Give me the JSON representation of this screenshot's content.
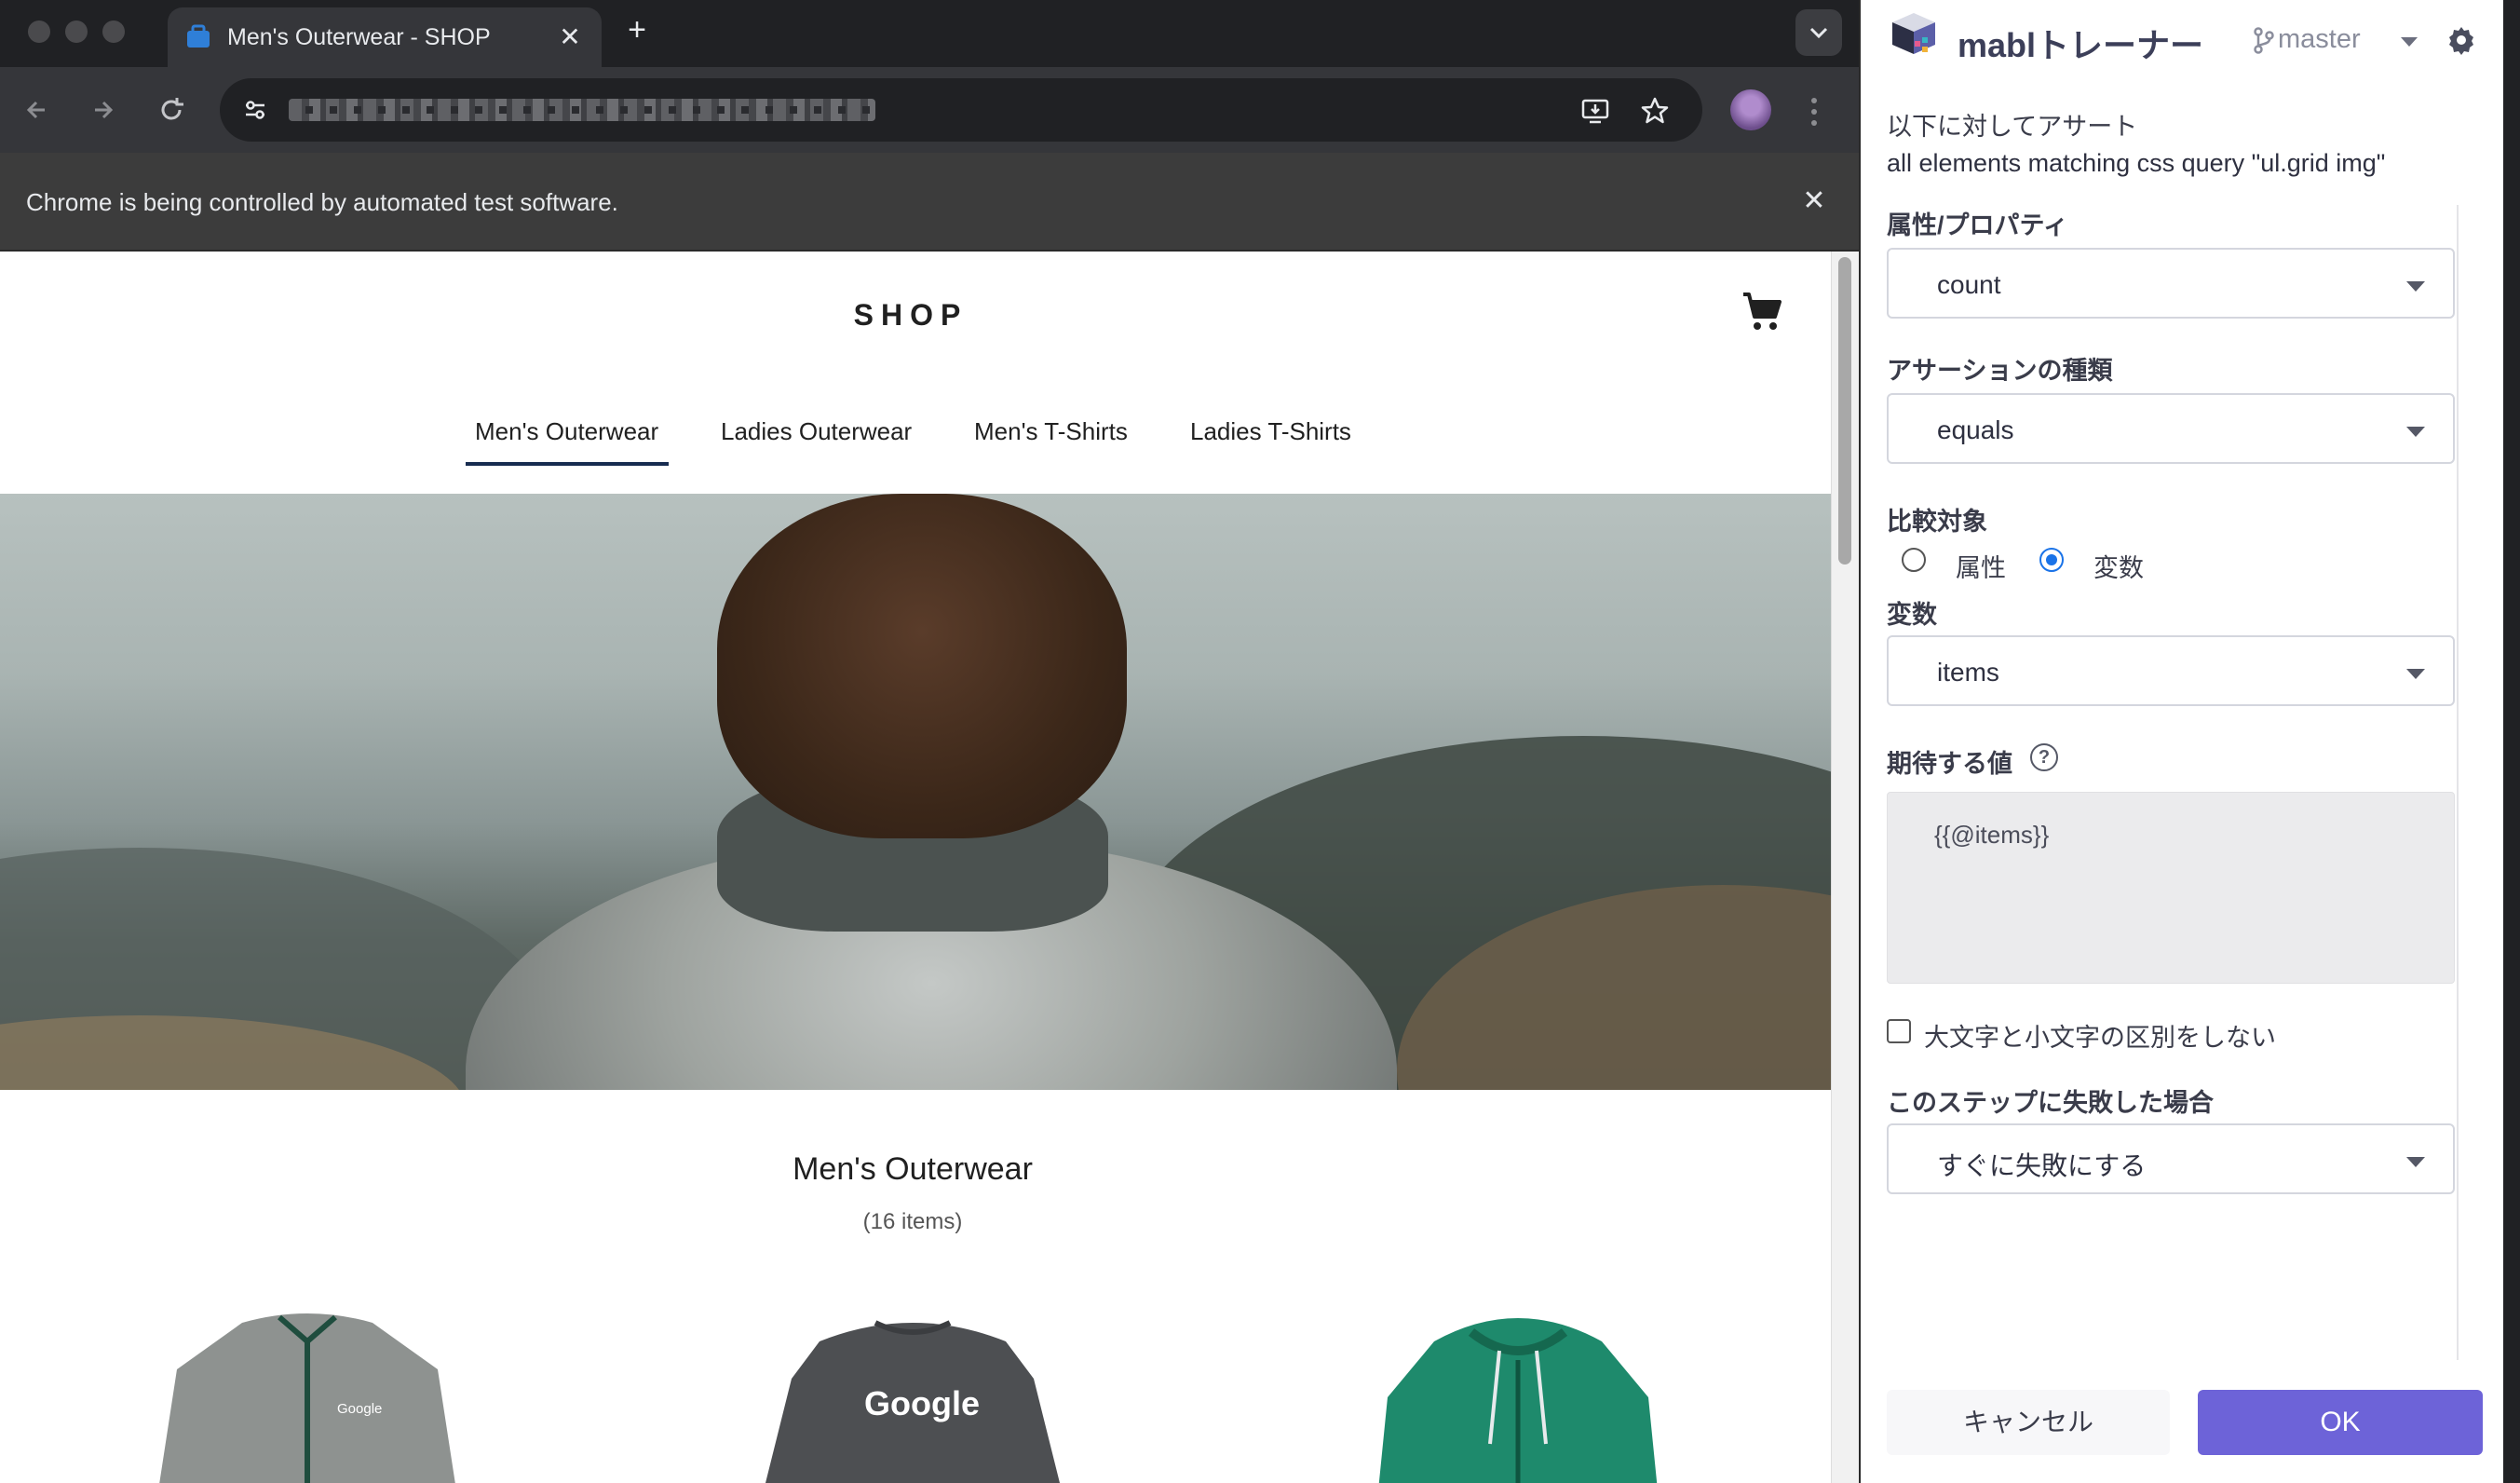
{
  "browser": {
    "tab": {
      "title": "Men's Outerwear - SHOP",
      "close_glyph": "✕"
    },
    "new_tab_glyph": "+",
    "infobar": {
      "text": "Chrome is being controlled by automated test software.",
      "close_glyph": "✕"
    }
  },
  "shop": {
    "title": "SHOP",
    "nav": [
      "Men's Outerwear",
      "Ladies Outerwear",
      "Men's T-Shirts",
      "Ladies T-Shirts"
    ],
    "active_nav": "Men's Outerwear",
    "category_title": "Men's Outerwear",
    "category_count": "(16 items)",
    "product_logo_text": "Google"
  },
  "trainer": {
    "title": "mablトレーナー",
    "branch": "master",
    "assert_heading": "以下に対してアサート",
    "assert_target": "all elements matching css query \"ul.grid img\"",
    "attribute_label": "属性/プロパティ",
    "attribute_value": "count",
    "assertion_type_label": "アサーションの種類",
    "assertion_type_value": "equals",
    "compare_label": "比較対象",
    "compare_options": [
      "属性",
      "変数"
    ],
    "compare_selected": "変数",
    "variable_label": "変数",
    "variable_value": "items",
    "expected_label": "期待する値",
    "help_glyph": "?",
    "expected_value": "{{@items}}",
    "case_insensitive_label": "大文字と小文字の区別をしない",
    "case_insensitive_checked": false,
    "on_failure_label": "このステップに失敗した場合",
    "on_failure_value": "すぐに失敗にする",
    "cancel_label": "キャンセル",
    "ok_label": "OK"
  },
  "colors": {
    "accent": "#6d63d8",
    "radio_selected": "#1a73e8",
    "nav_underline": "#172c50"
  },
  "icons": [
    "tab-favicon-icon",
    "back-arrow-icon",
    "forward-arrow-icon",
    "reload-icon",
    "site-settings-icon",
    "install-app-icon",
    "bookmark-star-icon",
    "kebab-menu-icon",
    "cart-icon",
    "branch-icon",
    "gear-icon",
    "mabl-logo-icon",
    "help-icon"
  ]
}
